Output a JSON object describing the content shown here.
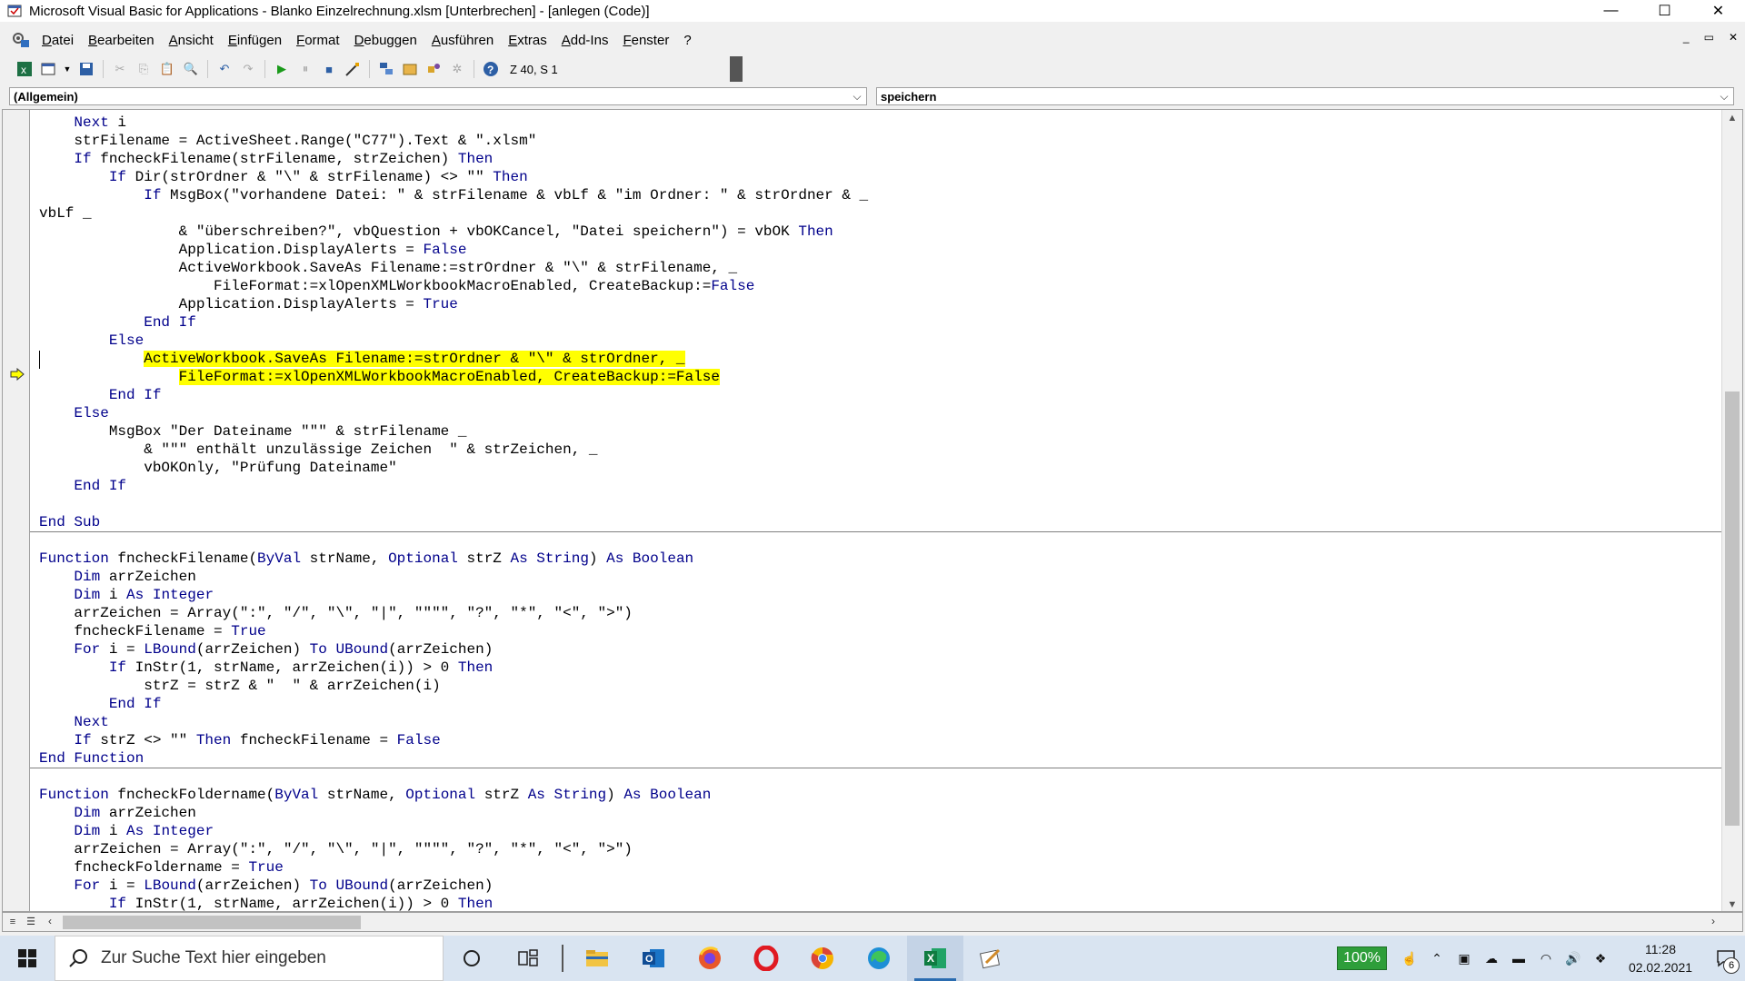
{
  "window": {
    "title": "Microsoft Visual Basic for Applications - Blanko Einzelrechnung.xlsm [Unterbrechen] - [anlegen (Code)]",
    "buttons": [
      "—",
      "☐",
      "✕"
    ]
  },
  "menu": {
    "items": [
      "Datei",
      "Bearbeiten",
      "Ansicht",
      "Einfügen",
      "Format",
      "Debuggen",
      "Ausführen",
      "Extras",
      "Add-Ins",
      "Fenster",
      "?"
    ],
    "mdi_buttons": [
      "_",
      "▭",
      "✕"
    ]
  },
  "toolbar": {
    "position_text": "Z 40, S 1"
  },
  "object_combo": {
    "value": "(Allgemein)"
  },
  "procedure_combo": {
    "value": "speichern"
  },
  "code": {
    "lines": [
      [
        {
          "t": "    "
        },
        {
          "t": "Next",
          "k": 1
        },
        {
          "t": " i"
        }
      ],
      [
        {
          "t": "    strFilename = ActiveSheet.Range(\"C77\").Text & \".xlsm\""
        }
      ],
      [
        {
          "t": "    "
        },
        {
          "t": "If",
          "k": 1
        },
        {
          "t": " fncheckFilename(strFilename, strZeichen) "
        },
        {
          "t": "Then",
          "k": 1
        }
      ],
      [
        {
          "t": "        "
        },
        {
          "t": "If",
          "k": 1
        },
        {
          "t": " Dir(strOrdner & \"\\\" & strFilename) <> \"\" "
        },
        {
          "t": "Then",
          "k": 1
        }
      ],
      [
        {
          "t": "            "
        },
        {
          "t": "If",
          "k": 1
        },
        {
          "t": " MsgBox(\"vorhandene Datei: \" & strFilename & vbLf & \"im Ordner: \" & strOrdner & _"
        }
      ],
      [
        {
          "t": "vbLf _"
        }
      ],
      [
        {
          "t": "                & \"überschreiben?\", vbQuestion + vbOKCancel, \"Datei speichern\") = vbOK "
        },
        {
          "t": "Then",
          "k": 1
        }
      ],
      [
        {
          "t": "                Application.DisplayAlerts = "
        },
        {
          "t": "False",
          "k": 1
        }
      ],
      [
        {
          "t": "                ActiveWorkbook.SaveAs Filename:=strOrdner & \"\\\" & strFilename, _"
        }
      ],
      [
        {
          "t": "                    FileFormat:=xlOpenXMLWorkbookMacroEnabled, CreateBackup:="
        },
        {
          "t": "False",
          "k": 1
        }
      ],
      [
        {
          "t": "                Application.DisplayAlerts = "
        },
        {
          "t": "True",
          "k": 1
        }
      ],
      [
        {
          "t": "            "
        },
        {
          "t": "End If",
          "k": 1
        }
      ],
      [
        {
          "t": "        "
        },
        {
          "t": "Else",
          "k": 1
        }
      ],
      [
        {
          "t": "            "
        },
        {
          "t": "ActiveWorkbook.SaveAs Filename:=strOrdner & \"\\\" & strOrdner, _",
          "h": 1
        }
      ],
      [
        {
          "t": "                "
        },
        {
          "t": "FileFormat:=xlOpenXMLWorkbookMacroEnabled, CreateBackup:=False",
          "h": 1
        }
      ],
      [
        {
          "t": "        "
        },
        {
          "t": "End If",
          "k": 1
        }
      ],
      [
        {
          "t": "    "
        },
        {
          "t": "Else",
          "k": 1
        }
      ],
      [
        {
          "t": "        MsgBox \"Der Dateiname \"\"\" & strFilename _"
        }
      ],
      [
        {
          "t": "            & \"\"\" enthält unzulässige Zeichen  \" & strZeichen, _"
        }
      ],
      [
        {
          "t": "            vbOKOnly, \"Prüfung Dateiname\""
        }
      ],
      [
        {
          "t": "    "
        },
        {
          "t": "End If",
          "k": 1
        }
      ],
      [
        {
          "t": ""
        }
      ],
      [
        {
          "t": "End Sub",
          "k": 1
        }
      ],
      [
        {
          "t": ""
        }
      ],
      [
        {
          "t": "Function",
          "k": 1
        },
        {
          "t": " fncheckFilename("
        },
        {
          "t": "ByVal",
          "k": 1
        },
        {
          "t": " strName, "
        },
        {
          "t": "Optional",
          "k": 1
        },
        {
          "t": " strZ "
        },
        {
          "t": "As String",
          "k": 1
        },
        {
          "t": ") "
        },
        {
          "t": "As Boolean",
          "k": 1
        }
      ],
      [
        {
          "t": "    "
        },
        {
          "t": "Dim",
          "k": 1
        },
        {
          "t": " arrZeichen"
        }
      ],
      [
        {
          "t": "    "
        },
        {
          "t": "Dim",
          "k": 1
        },
        {
          "t": " i "
        },
        {
          "t": "As Integer",
          "k": 1
        }
      ],
      [
        {
          "t": "    arrZeichen = Array(\":\", \"/\", \"\\\", \"|\", \"\"\"\", \"?\", \"*\", \"<\", \">\")"
        }
      ],
      [
        {
          "t": "    fncheckFilename = "
        },
        {
          "t": "True",
          "k": 1
        }
      ],
      [
        {
          "t": "    "
        },
        {
          "t": "For",
          "k": 1
        },
        {
          "t": " i = "
        },
        {
          "t": "LBound",
          "k": 1
        },
        {
          "t": "(arrZeichen) "
        },
        {
          "t": "To",
          "k": 1
        },
        {
          "t": " "
        },
        {
          "t": "UBound",
          "k": 1
        },
        {
          "t": "(arrZeichen)"
        }
      ],
      [
        {
          "t": "        "
        },
        {
          "t": "If",
          "k": 1
        },
        {
          "t": " InStr(1, strName, arrZeichen(i)) > 0 "
        },
        {
          "t": "Then",
          "k": 1
        }
      ],
      [
        {
          "t": "            strZ = strZ & \"  \" & arrZeichen(i)"
        }
      ],
      [
        {
          "t": "        "
        },
        {
          "t": "End If",
          "k": 1
        }
      ],
      [
        {
          "t": "    "
        },
        {
          "t": "Next",
          "k": 1
        }
      ],
      [
        {
          "t": "    "
        },
        {
          "t": "If",
          "k": 1
        },
        {
          "t": " strZ <> \"\" "
        },
        {
          "t": "Then",
          "k": 1
        },
        {
          "t": " fncheckFilename = "
        },
        {
          "t": "False",
          "k": 1
        }
      ],
      [
        {
          "t": "End Function",
          "k": 1
        }
      ],
      [
        {
          "t": ""
        }
      ],
      [
        {
          "t": "Function",
          "k": 1
        },
        {
          "t": " fncheckFoldername("
        },
        {
          "t": "ByVal",
          "k": 1
        },
        {
          "t": " strName, "
        },
        {
          "t": "Optional",
          "k": 1
        },
        {
          "t": " strZ "
        },
        {
          "t": "As String",
          "k": 1
        },
        {
          "t": ") "
        },
        {
          "t": "As Boolean",
          "k": 1
        }
      ],
      [
        {
          "t": "    "
        },
        {
          "t": "Dim",
          "k": 1
        },
        {
          "t": " arrZeichen"
        }
      ],
      [
        {
          "t": "    "
        },
        {
          "t": "Dim",
          "k": 1
        },
        {
          "t": " i "
        },
        {
          "t": "As Integer",
          "k": 1
        }
      ],
      [
        {
          "t": "    arrZeichen = Array(\":\", \"/\", \"\\\", \"|\", \"\"\"\", \"?\", \"*\", \"<\", \">\")"
        }
      ],
      [
        {
          "t": "    fncheckFoldername = "
        },
        {
          "t": "True",
          "k": 1
        }
      ],
      [
        {
          "t": "    "
        },
        {
          "t": "For",
          "k": 1
        },
        {
          "t": " i = "
        },
        {
          "t": "LBound",
          "k": 1
        },
        {
          "t": "(arrZeichen) "
        },
        {
          "t": "To",
          "k": 1
        },
        {
          "t": " "
        },
        {
          "t": "UBound",
          "k": 1
        },
        {
          "t": "(arrZeichen)"
        }
      ],
      [
        {
          "t": "        "
        },
        {
          "t": "If",
          "k": 1
        },
        {
          "t": " InStr(1, strName, arrZeichen(i)) > 0 "
        },
        {
          "t": "Then",
          "k": 1
        }
      ]
    ]
  },
  "taskbar": {
    "search_placeholder": "Zur Suche Text hier eingeben",
    "zoom": "100%",
    "time": "11:28",
    "date": "02.02.2021",
    "notification_count": "6"
  },
  "colors": {
    "keyword": "#00008b",
    "highlight": "#ffff00",
    "taskbar": "#d9e4f1"
  }
}
